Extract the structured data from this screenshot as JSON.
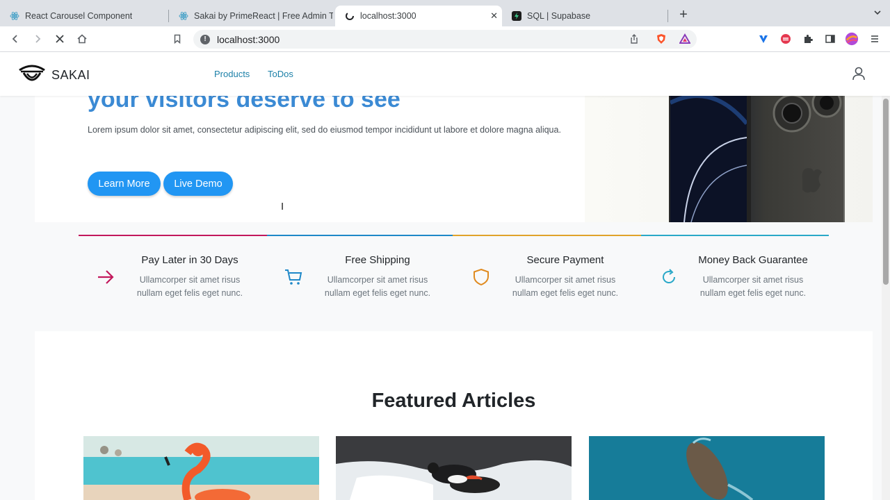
{
  "browser": {
    "tabs": [
      {
        "title": "React Carousel Component",
        "favicon": "react-icon",
        "active": false
      },
      {
        "title": "Sakai by PrimeReact | Free Admin Te",
        "favicon": "react-icon",
        "active": false
      },
      {
        "title": "localhost:3000",
        "favicon": "loading-icon",
        "active": true
      },
      {
        "title": "SQL | Supabase",
        "favicon": "supabase-icon",
        "active": false
      }
    ],
    "url": "localhost:3000",
    "new_tab_label": "+"
  },
  "app": {
    "logo_text": "SAKAI",
    "nav": [
      {
        "label": "Products"
      },
      {
        "label": "ToDos"
      }
    ]
  },
  "hero": {
    "title": "your visitors deserve to see",
    "text": "Lorem ipsum dolor sit amet, consectetur adipiscing elit, sed do eiusmod tempor incididunt ut labore et dolore magna aliqua.",
    "buttons": [
      {
        "label": "Learn More"
      },
      {
        "label": "Live Demo"
      }
    ]
  },
  "features": [
    {
      "title": "Pay Later in 30 Days",
      "desc": "Ullamcorper sit amet risus nullam eget felis eget nunc.",
      "icon": "arrow-right-icon",
      "color": "#c2185b"
    },
    {
      "title": "Free Shipping",
      "desc": "Ullamcorper sit amet risus nullam eget felis eget nunc.",
      "icon": "shopping-cart-icon",
      "color": "#1e88c8"
    },
    {
      "title": "Secure Payment",
      "desc": "Ullamcorper sit amet risus nullam eget felis eget nunc.",
      "icon": "shield-icon",
      "color": "#e08a1e"
    },
    {
      "title": "Money Back Guarantee",
      "desc": "Ullamcorper sit amet risus nullam eget felis eget nunc.",
      "icon": "refresh-icon",
      "color": "#29a8c8"
    }
  ],
  "articles": {
    "title": "Featured Articles"
  },
  "colors": {
    "accent": "#2196f3",
    "nav_link": "#1c80a8",
    "hero_title": "#3b8ad4"
  }
}
